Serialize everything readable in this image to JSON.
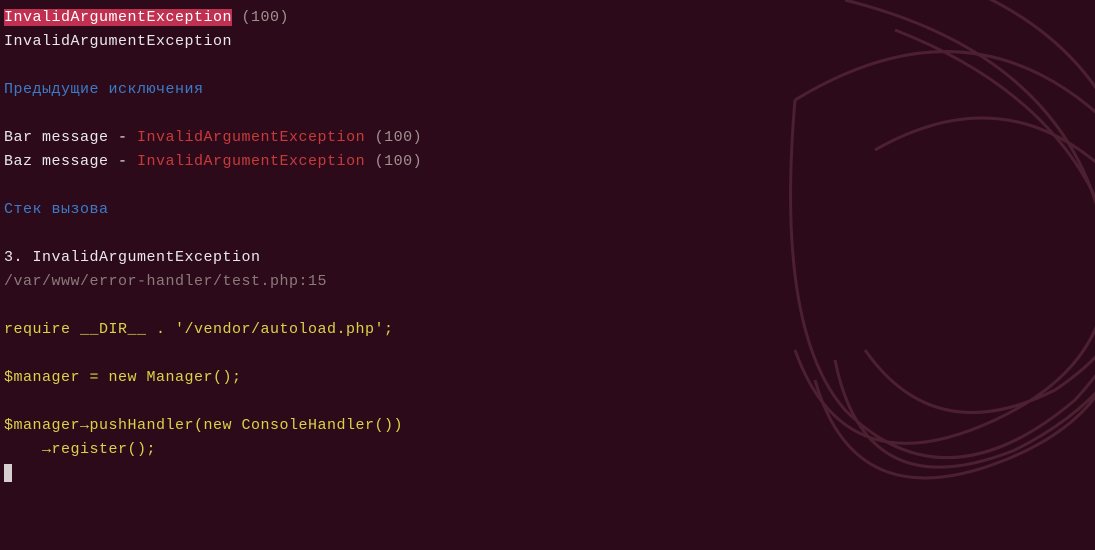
{
  "header": {
    "exception1_name": "InvalidArgumentException",
    "exception1_code": " (100)",
    "exception1_repeat": "InvalidArgumentException"
  },
  "sections": {
    "previous": "Предыдущие исключения",
    "stack": "Стек вызова"
  },
  "previous": [
    {
      "msg": "Bar message - ",
      "exc": "InvalidArgumentException",
      "code": " (100)"
    },
    {
      "msg": "Baz message - ",
      "exc": "InvalidArgumentException",
      "code": " (100)"
    }
  ],
  "stack": {
    "frame_num": "3. ",
    "frame_exc": "InvalidArgumentException",
    "file": "/var/www/error-handler/test.php:15"
  },
  "code": {
    "l1": "require __DIR__ . '/vendor/autoload.php';",
    "l2": "$manager = new Manager();",
    "l3": "$manager→pushHandler(new ConsoleHandler())",
    "l4": "    →register();"
  }
}
